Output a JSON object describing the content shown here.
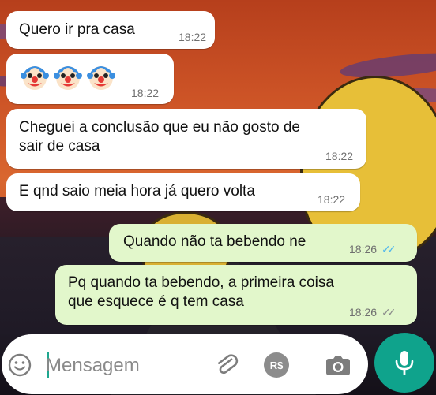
{
  "messages": [
    {
      "text": "Quero ir pra casa",
      "time": "18:22",
      "direction": "in"
    },
    {
      "emoji": [
        "clown-face",
        "clown-face",
        "clown-face"
      ],
      "time": "18:22",
      "direction": "in"
    },
    {
      "text": "Cheguei a conclusão que eu não gosto de\nsair de casa",
      "time": "18:22",
      "direction": "in"
    },
    {
      "text": "E qnd saio meia hora já quero volta",
      "time": "18:22",
      "direction": "in"
    },
    {
      "text": "Quando não ta bebendo ne",
      "time": "18:26",
      "direction": "out",
      "status": "read"
    },
    {
      "text": "Pq quando ta bebendo, a primeira coisa\nque esquece é q tem casa",
      "time": "18:26",
      "direction": "out",
      "status": "read"
    }
  ],
  "composer": {
    "placeholder": "Mensagem",
    "icons": [
      "emoji-icon",
      "paperclip-icon",
      "payment-icon",
      "camera-icon",
      "microphone-icon"
    ],
    "payment_label": "R$"
  },
  "colors": {
    "incoming_bubble": "#ffffff",
    "outgoing_bubble": "#e2f7cb",
    "read_ticks": "#4fb6ec",
    "mic_button": "#0fa38c"
  }
}
